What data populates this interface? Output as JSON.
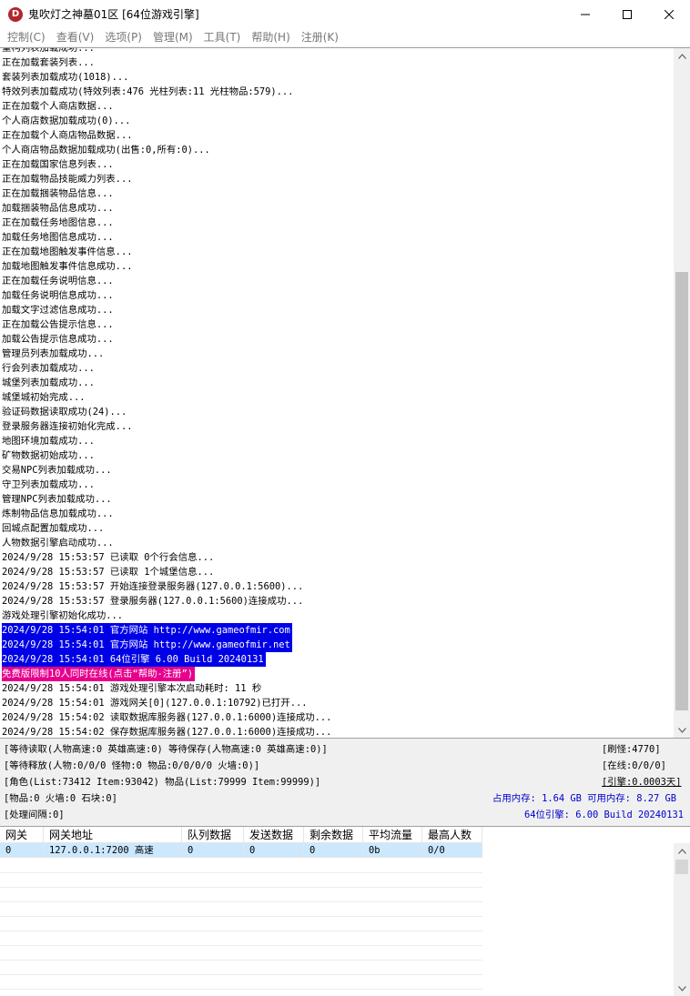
{
  "window": {
    "title": "鬼吹灯之神墓01区 [64位游戏引擎]",
    "icon": "app-logo-icon",
    "icon_letter": "D"
  },
  "menu": [
    "控制(C)",
    "查看(V)",
    "选项(P)",
    "管理(M)",
    "工具(T)",
    "帮助(H)",
    "注册(K)"
  ],
  "log": {
    "lines": [
      {
        "text": "重构列表加载成功...",
        "style": "normal"
      },
      {
        "text": "正在加载套装列表...",
        "style": "normal"
      },
      {
        "text": "套装列表加载成功(1018)...",
        "style": "normal"
      },
      {
        "text": "特效列表加载成功(特效列表:476 光柱列表:11 光柱物品:579)...",
        "style": "normal"
      },
      {
        "text": "正在加载个人商店数据...",
        "style": "normal"
      },
      {
        "text": "个人商店数据加载成功(0)...",
        "style": "normal"
      },
      {
        "text": "正在加载个人商店物品数据...",
        "style": "normal"
      },
      {
        "text": "个人商店物品数据加载成功(出售:0,所有:0)...",
        "style": "normal"
      },
      {
        "text": "正在加载国家信息列表...",
        "style": "normal"
      },
      {
        "text": "正在加载物品技能威力列表...",
        "style": "normal"
      },
      {
        "text": "正在加载捆装物品信息...",
        "style": "normal"
      },
      {
        "text": "加载捆装物品信息成功...",
        "style": "normal"
      },
      {
        "text": "正在加载任务地图信息...",
        "style": "normal"
      },
      {
        "text": "加载任务地图信息成功...",
        "style": "normal"
      },
      {
        "text": "正在加载地图触发事件信息...",
        "style": "normal"
      },
      {
        "text": "加载地图触发事件信息成功...",
        "style": "normal"
      },
      {
        "text": "正在加载任务说明信息...",
        "style": "normal"
      },
      {
        "text": "加载任务说明信息成功...",
        "style": "normal"
      },
      {
        "text": "加载文字过滤信息成功...",
        "style": "normal"
      },
      {
        "text": "正在加载公告提示信息...",
        "style": "normal"
      },
      {
        "text": "加载公告提示信息成功...",
        "style": "normal"
      },
      {
        "text": "管理员列表加载成功...",
        "style": "normal"
      },
      {
        "text": "行会列表加载成功...",
        "style": "normal"
      },
      {
        "text": "城堡列表加载成功...",
        "style": "normal"
      },
      {
        "text": "城堡城初始完成...",
        "style": "normal"
      },
      {
        "text": "验证码数据读取成功(24)...",
        "style": "normal"
      },
      {
        "text": "登录服务器连接初始化完成...",
        "style": "normal"
      },
      {
        "text": "地图环境加载成功...",
        "style": "normal"
      },
      {
        "text": "矿物数据初始成功...",
        "style": "normal"
      },
      {
        "text": "交易NPC列表加载成功...",
        "style": "normal"
      },
      {
        "text": "守卫列表加载成功...",
        "style": "normal"
      },
      {
        "text": "管理NPC列表加载成功...",
        "style": "normal"
      },
      {
        "text": "炼制物品信息加载成功...",
        "style": "normal"
      },
      {
        "text": "回城点配置加载成功...",
        "style": "normal"
      },
      {
        "text": "人物数据引擎启动成功...",
        "style": "normal"
      },
      {
        "text": "2024/9/28 15:53:57 已读取 0个行会信息...",
        "style": "normal"
      },
      {
        "text": "2024/9/28 15:53:57 已读取 1个城堡信息...",
        "style": "normal"
      },
      {
        "text": "2024/9/28 15:53:57 开始连接登录服务器(127.0.0.1:5600)...",
        "style": "normal"
      },
      {
        "text": "2024/9/28 15:53:57 登录服务器(127.0.0.1:5600)连接成功...",
        "style": "normal"
      },
      {
        "text": "游戏处理引擎初始化成功...",
        "style": "normal"
      },
      {
        "text": "2024/9/28 15:54:01 官方网站 http://www.gameofmir.com",
        "style": "blue"
      },
      {
        "text": "2024/9/28 15:54:01 官方网站 http://www.gameofmir.net",
        "style": "blue"
      },
      {
        "text": "2024/9/28 15:54:01 64位引擎 6.00 Build 20240131",
        "style": "blue"
      },
      {
        "text": "免费版限制10人同时在线(点击“帮助-注册”)",
        "style": "pink"
      },
      {
        "text": "2024/9/28 15:54:01 游戏处理引擎本次启动耗时: 11 秒",
        "style": "normal"
      },
      {
        "text": "2024/9/28 15:54:01 游戏网关[0](127.0.0.1:10792)已打开...",
        "style": "normal"
      },
      {
        "text": "2024/9/28 15:54:02 读取数据库服务器(127.0.0.1:6000)连接成功...",
        "style": "normal"
      },
      {
        "text": "2024/9/28 15:54:02 保存数据库服务器(127.0.0.1:6000)连接成功...",
        "style": "normal"
      }
    ]
  },
  "status": {
    "line1": "[等待读取(人物高速:0 英雄高速:0) 等待保存(人物高速:0 英雄高速:0)]",
    "line2": "[等待释放(人物:0/0/0 怪物:0 物品:0/0/0/0 火墙:0)]",
    "line3": "[角色(List:73412 Item:93042) 物品(List:79999 Item:99999)]",
    "line4": "[物品:0 火墙:0 石块:0]",
    "line5": "[处理间隔:0]",
    "refresh_monster": "[刷怪:4770]",
    "online": "[在线:0/0/0]",
    "engine_uptime": "[引擎:0.0003天]",
    "memory": "占用内存: 1.64 GB 可用内存: 8.27 GB",
    "engine_build": "64位引擎: 6.00 Build 20240131"
  },
  "gateway_table": {
    "columns": [
      "网关",
      "网关地址",
      "队列数据",
      "发送数据",
      "剩余数据",
      "平均流量",
      "最高人数"
    ],
    "rows": [
      [
        "0",
        "127.0.0.1:7200 高速",
        "0",
        "0",
        "0",
        "0b",
        "0/0"
      ]
    ]
  }
}
